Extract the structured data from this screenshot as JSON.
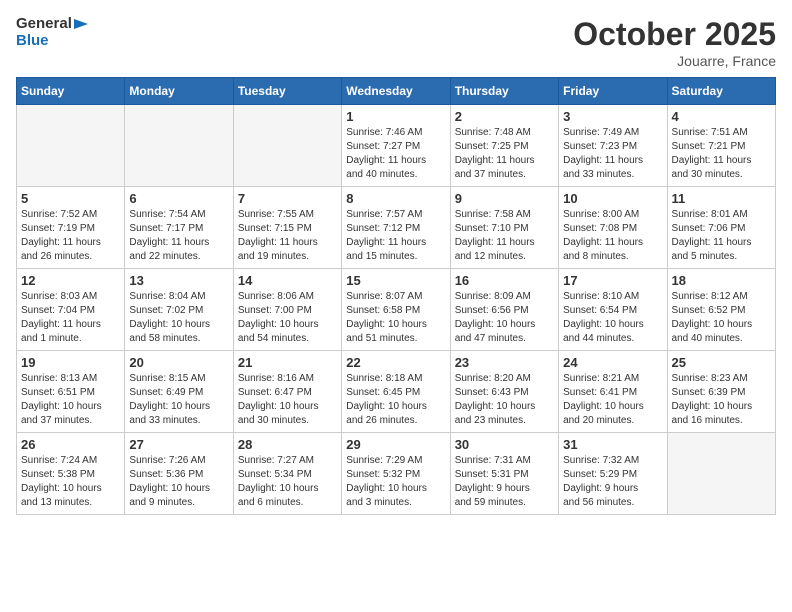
{
  "logo": {
    "text_general": "General",
    "text_blue": "Blue"
  },
  "title": "October 2025",
  "location": "Jouarre, France",
  "weekdays": [
    "Sunday",
    "Monday",
    "Tuesday",
    "Wednesday",
    "Thursday",
    "Friday",
    "Saturday"
  ],
  "weeks": [
    [
      {
        "day": "",
        "info": ""
      },
      {
        "day": "",
        "info": ""
      },
      {
        "day": "",
        "info": ""
      },
      {
        "day": "1",
        "info": "Sunrise: 7:46 AM\nSunset: 7:27 PM\nDaylight: 11 hours\nand 40 minutes."
      },
      {
        "day": "2",
        "info": "Sunrise: 7:48 AM\nSunset: 7:25 PM\nDaylight: 11 hours\nand 37 minutes."
      },
      {
        "day": "3",
        "info": "Sunrise: 7:49 AM\nSunset: 7:23 PM\nDaylight: 11 hours\nand 33 minutes."
      },
      {
        "day": "4",
        "info": "Sunrise: 7:51 AM\nSunset: 7:21 PM\nDaylight: 11 hours\nand 30 minutes."
      }
    ],
    [
      {
        "day": "5",
        "info": "Sunrise: 7:52 AM\nSunset: 7:19 PM\nDaylight: 11 hours\nand 26 minutes."
      },
      {
        "day": "6",
        "info": "Sunrise: 7:54 AM\nSunset: 7:17 PM\nDaylight: 11 hours\nand 22 minutes."
      },
      {
        "day": "7",
        "info": "Sunrise: 7:55 AM\nSunset: 7:15 PM\nDaylight: 11 hours\nand 19 minutes."
      },
      {
        "day": "8",
        "info": "Sunrise: 7:57 AM\nSunset: 7:12 PM\nDaylight: 11 hours\nand 15 minutes."
      },
      {
        "day": "9",
        "info": "Sunrise: 7:58 AM\nSunset: 7:10 PM\nDaylight: 11 hours\nand 12 minutes."
      },
      {
        "day": "10",
        "info": "Sunrise: 8:00 AM\nSunset: 7:08 PM\nDaylight: 11 hours\nand 8 minutes."
      },
      {
        "day": "11",
        "info": "Sunrise: 8:01 AM\nSunset: 7:06 PM\nDaylight: 11 hours\nand 5 minutes."
      }
    ],
    [
      {
        "day": "12",
        "info": "Sunrise: 8:03 AM\nSunset: 7:04 PM\nDaylight: 11 hours\nand 1 minute."
      },
      {
        "day": "13",
        "info": "Sunrise: 8:04 AM\nSunset: 7:02 PM\nDaylight: 10 hours\nand 58 minutes."
      },
      {
        "day": "14",
        "info": "Sunrise: 8:06 AM\nSunset: 7:00 PM\nDaylight: 10 hours\nand 54 minutes."
      },
      {
        "day": "15",
        "info": "Sunrise: 8:07 AM\nSunset: 6:58 PM\nDaylight: 10 hours\nand 51 minutes."
      },
      {
        "day": "16",
        "info": "Sunrise: 8:09 AM\nSunset: 6:56 PM\nDaylight: 10 hours\nand 47 minutes."
      },
      {
        "day": "17",
        "info": "Sunrise: 8:10 AM\nSunset: 6:54 PM\nDaylight: 10 hours\nand 44 minutes."
      },
      {
        "day": "18",
        "info": "Sunrise: 8:12 AM\nSunset: 6:52 PM\nDaylight: 10 hours\nand 40 minutes."
      }
    ],
    [
      {
        "day": "19",
        "info": "Sunrise: 8:13 AM\nSunset: 6:51 PM\nDaylight: 10 hours\nand 37 minutes."
      },
      {
        "day": "20",
        "info": "Sunrise: 8:15 AM\nSunset: 6:49 PM\nDaylight: 10 hours\nand 33 minutes."
      },
      {
        "day": "21",
        "info": "Sunrise: 8:16 AM\nSunset: 6:47 PM\nDaylight: 10 hours\nand 30 minutes."
      },
      {
        "day": "22",
        "info": "Sunrise: 8:18 AM\nSunset: 6:45 PM\nDaylight: 10 hours\nand 26 minutes."
      },
      {
        "day": "23",
        "info": "Sunrise: 8:20 AM\nSunset: 6:43 PM\nDaylight: 10 hours\nand 23 minutes."
      },
      {
        "day": "24",
        "info": "Sunrise: 8:21 AM\nSunset: 6:41 PM\nDaylight: 10 hours\nand 20 minutes."
      },
      {
        "day": "25",
        "info": "Sunrise: 8:23 AM\nSunset: 6:39 PM\nDaylight: 10 hours\nand 16 minutes."
      }
    ],
    [
      {
        "day": "26",
        "info": "Sunrise: 7:24 AM\nSunset: 5:38 PM\nDaylight: 10 hours\nand 13 minutes."
      },
      {
        "day": "27",
        "info": "Sunrise: 7:26 AM\nSunset: 5:36 PM\nDaylight: 10 hours\nand 9 minutes."
      },
      {
        "day": "28",
        "info": "Sunrise: 7:27 AM\nSunset: 5:34 PM\nDaylight: 10 hours\nand 6 minutes."
      },
      {
        "day": "29",
        "info": "Sunrise: 7:29 AM\nSunset: 5:32 PM\nDaylight: 10 hours\nand 3 minutes."
      },
      {
        "day": "30",
        "info": "Sunrise: 7:31 AM\nSunset: 5:31 PM\nDaylight: 9 hours\nand 59 minutes."
      },
      {
        "day": "31",
        "info": "Sunrise: 7:32 AM\nSunset: 5:29 PM\nDaylight: 9 hours\nand 56 minutes."
      },
      {
        "day": "",
        "info": ""
      }
    ]
  ]
}
